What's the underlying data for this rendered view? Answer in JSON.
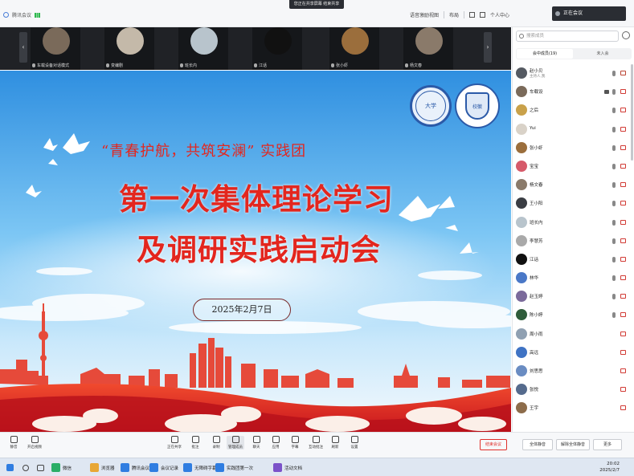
{
  "topbar": {
    "left_label": "腾讯会议",
    "center_label": "您正在共享屏幕  结束共享",
    "view_label": "语音激励视图",
    "layout_label": "布局",
    "participants_label": "共享数",
    "user_label": "个人中心",
    "notification": "正在会议"
  },
  "video_strip": [
    {
      "name": "车载设备对话模式",
      "color": "#7a6a5a"
    },
    {
      "name": "变编剧",
      "color": "#c4b9a9"
    },
    {
      "name": "班长内",
      "color": "#b8c4cc"
    },
    {
      "name": "江话",
      "color": "#111111"
    },
    {
      "name": "张小虾",
      "color": "#9b6e3c"
    },
    {
      "name": "杨文春",
      "color": "#8a7a6a"
    }
  ],
  "slide": {
    "subtitle": "“青春护航，共筑安澜” 实践团",
    "title_line1": "第一次集体理论学习",
    "title_line2": "及调研实践启动会",
    "date": "2025年2月7日",
    "logo1_text": "大学",
    "logo2_text": "校徽"
  },
  "toolbar": {
    "items": [
      "静音",
      "开启视频",
      "正在共享",
      "批注",
      "录制",
      "管理成员",
      "聊天",
      "应用",
      "字幕",
      "互动批注",
      "刷新",
      "设置"
    ],
    "end_label": "结束会议",
    "panel_buttons": [
      "全体静音",
      "解除全体静音",
      "更多"
    ]
  },
  "taskbar": {
    "items": [
      {
        "label": "微信",
        "color": "#2aae67"
      },
      {
        "label": "浏览器",
        "color": "#e8a735"
      },
      {
        "label": "腾讯会议",
        "color": "#2f7de1"
      },
      {
        "label": "会议记录",
        "color": "#2f7de1"
      },
      {
        "label": "无障碍字幕",
        "color": "#2f7de1"
      },
      {
        "label": "实践团第一次",
        "color": "#2f7de1"
      },
      {
        "label": "活动文档",
        "color": "#7b52c9"
      }
    ],
    "time": "20:02",
    "date": "2025/2/7"
  },
  "panel": {
    "search_placeholder": "搜索成员",
    "tab_all": "会中成员(19)",
    "tab_waiting": "未入会",
    "participants": [
      {
        "name": "赵小贝",
        "sub": "主持人,我",
        "color": "#555a62"
      },
      {
        "name": "车载设",
        "sub": "",
        "color": "#7a6a5a"
      },
      {
        "name": "之后",
        "sub": "",
        "color": "#c9a14a"
      },
      {
        "name": "Yui",
        "sub": "",
        "color": "#d9d2c8"
      },
      {
        "name": "张小虾",
        "sub": "",
        "color": "#9b6e3c"
      },
      {
        "name": "宝宝",
        "sub": "",
        "color": "#d65a6a"
      },
      {
        "name": "杨文春",
        "sub": "",
        "color": "#8a7a6a"
      },
      {
        "name": "王小阳",
        "sub": "",
        "color": "#3a3d43"
      },
      {
        "name": "班长内",
        "sub": "",
        "color": "#b8c4cc"
      },
      {
        "name": "李慧芳",
        "sub": "",
        "color": "#a9a9a9"
      },
      {
        "name": "江话",
        "sub": "",
        "color": "#111111"
      },
      {
        "name": "林华",
        "sub": "",
        "color": "#4a78c7"
      },
      {
        "name": "赵玉婷",
        "sub": "",
        "color": "#7b6a9b"
      },
      {
        "name": "陈小婷",
        "sub": "",
        "color": "#2f5c3a"
      },
      {
        "name": "周小雨",
        "sub": "",
        "color": "#8fa0b2"
      },
      {
        "name": "高远",
        "sub": "",
        "color": "#3f73c4"
      },
      {
        "name": "刘思思",
        "sub": "",
        "color": "#6a8cc2"
      },
      {
        "name": "张悦",
        "sub": "",
        "color": "#556b8d"
      },
      {
        "name": "王宇",
        "sub": "",
        "color": "#8d6c4a"
      }
    ]
  }
}
